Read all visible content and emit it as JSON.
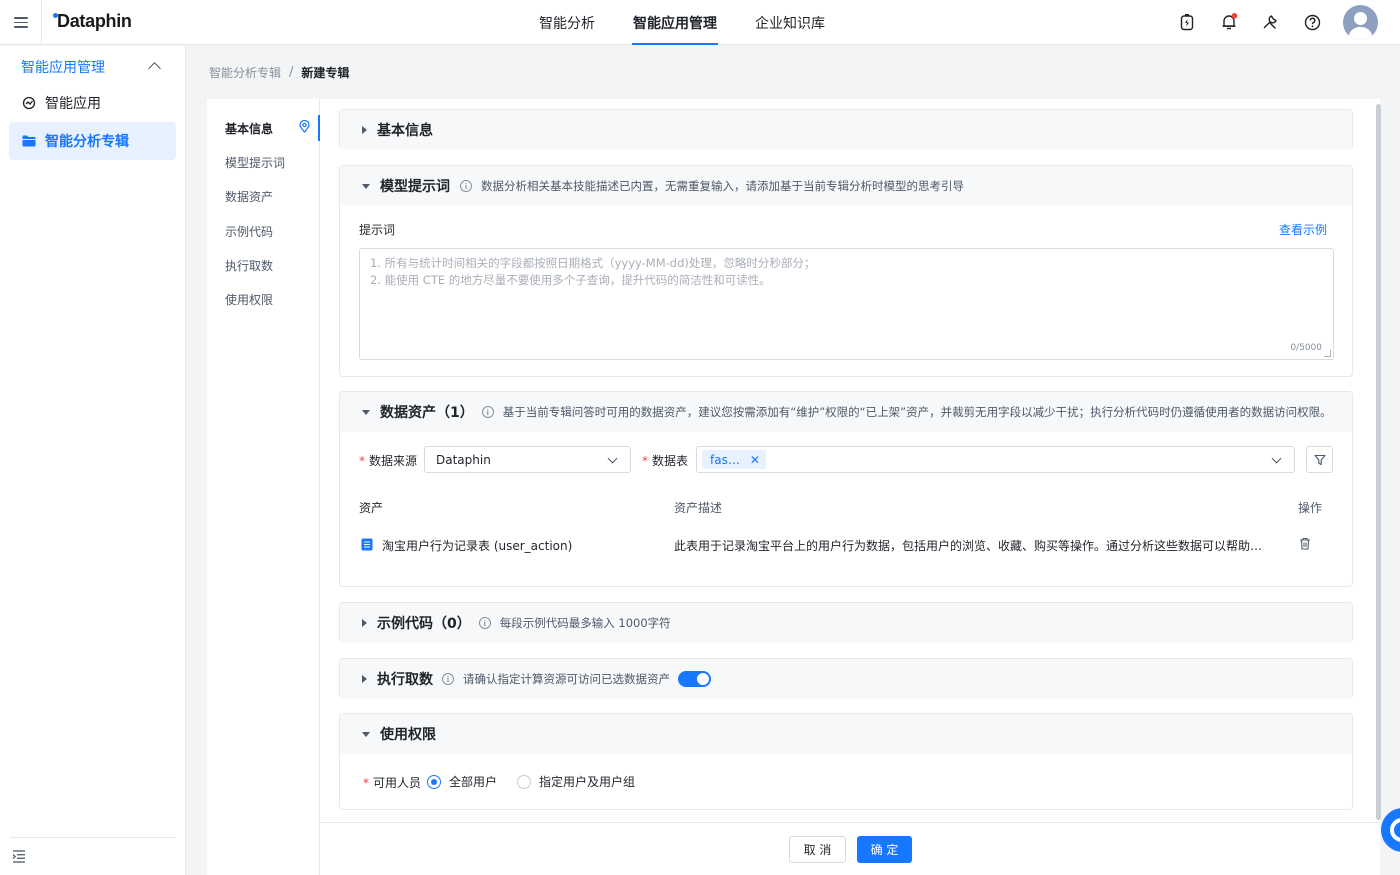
{
  "app": {
    "logo": "Dataphin"
  },
  "nav": [
    {
      "label": "智能分析",
      "active": false
    },
    {
      "label": "智能应用管理",
      "active": true
    },
    {
      "label": "企业知识库",
      "active": false
    }
  ],
  "top_icons": [
    "power-bank-icon",
    "bell-icon",
    "tools-icon",
    "help-icon",
    "avatar"
  ],
  "sidebar": {
    "group": "智能应用管理",
    "items": [
      {
        "label": "智能应用",
        "icon": "app-ring-icon",
        "active": false
      },
      {
        "label": "智能分析专辑",
        "icon": "folder-icon",
        "active": true
      }
    ]
  },
  "breadcrumb": {
    "parent": "智能分析专辑",
    "separator": "/",
    "current": "新建专辑"
  },
  "anchor_nav": [
    "基本信息",
    "模型提示词",
    "数据资产",
    "示例代码",
    "执行取数",
    "使用权限"
  ],
  "sections": {
    "basic": {
      "title": "基本信息"
    },
    "prompt": {
      "title": "模型提示词",
      "desc": "数据分析相关基本技能描述已内置，无需重复输入，请添加基于当前专辑分析时模型的思考引导",
      "field_label": "提示词",
      "example_link": "查看示例",
      "placeholder": "1. 所有与统计时间相关的字段都按照日期格式（yyyy-MM-dd)处理，忽略时分秒部分；\n2. 能使用 CTE 的地方尽量不要使用多个子查询，提升代码的简洁性和可读性。",
      "counter": "0/5000"
    },
    "assets": {
      "title": "数据资产（1）",
      "desc": "基于当前专辑问答时可用的数据资产，建议您按需添加有“维护”权限的“已上架”资产，并裁剪无用字段以减少干扰；执行分析代码时仍遵循使用者的数据访问权限。",
      "source_label": "数据来源",
      "source_value": "Dataphin",
      "table_label": "数据表",
      "table_tag": "fas…",
      "columns": [
        "资产",
        "资产描述",
        "操作"
      ],
      "rows": [
        {
          "name": "淘宝用户行为记录表 (user_action)",
          "desc": "此表用于记录淘宝平台上的用户行为数据，包括用户的浏览、收藏、购买等操作。通过分析这些数据可以帮助理解…"
        }
      ]
    },
    "code": {
      "title": "示例代码（0）",
      "desc": "每段示例代码最多输入 1000字符"
    },
    "exec": {
      "title": "执行取数",
      "desc": "请确认指定计算资源可访问已选数据资产",
      "switch_on": true
    },
    "perm": {
      "title": "使用权限",
      "label": "可用人员",
      "options": [
        {
          "label": "全部用户",
          "checked": true
        },
        {
          "label": "指定用户及用户组",
          "checked": false
        }
      ]
    }
  },
  "footer": {
    "cancel": "取 消",
    "ok": "确 定"
  },
  "colors": {
    "primary": "#1677ff",
    "notify_dot": "#f53f3f"
  }
}
